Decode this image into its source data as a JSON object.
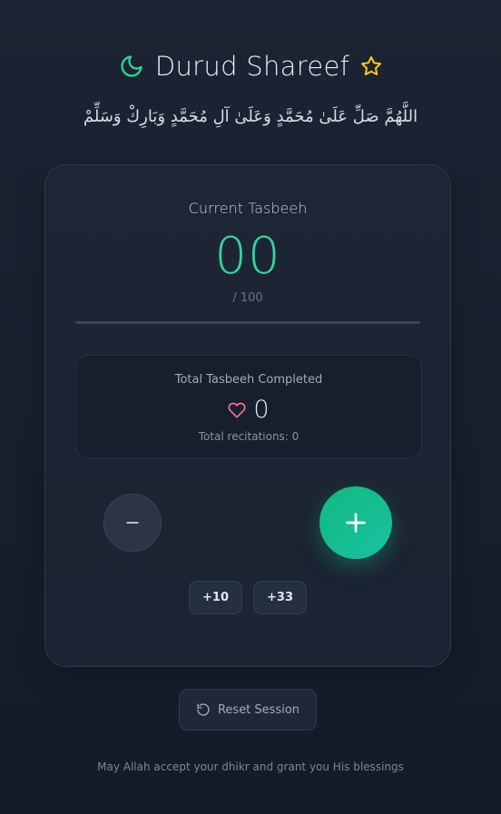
{
  "header": {
    "title": "Durud Shareef",
    "left_icon": "moon-icon",
    "right_icon": "star-icon",
    "accent_color": "#34d399",
    "star_color": "#facc15"
  },
  "arabic_text": "اللَّهُمَّ صَلِّ عَلَىٰ مُحَمَّدٍ وَعَلَىٰ آلِ مُحَمَّدٍ وَبَارِكْ وَسَلِّمْ",
  "counter": {
    "label": "Current Tasbeeh",
    "value": "00",
    "target": "/ 100",
    "progress": 0
  },
  "totals": {
    "label": "Total Tasbeeh Completed",
    "icon": "heart-icon",
    "value": "0",
    "recitations": "Total recitations: 0"
  },
  "controls": {
    "decrement_icon": "minus-icon",
    "increment_icon": "plus-icon",
    "quick_add": [
      "+10",
      "+33"
    ]
  },
  "reset": {
    "icon": "rotate-ccw-icon",
    "label": "Reset Session"
  },
  "footer": "May Allah accept your dhikr and grant you His blessings"
}
